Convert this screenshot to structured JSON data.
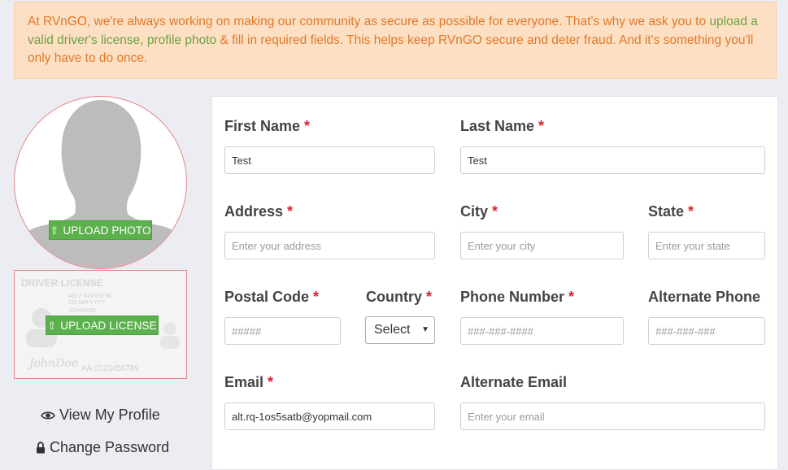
{
  "notice": {
    "part1": "At RVnGO, we're always working on making our community as secure as possible for everyone. That's why we ask you to",
    "highlight": "upload a valid driver's license, profile photo",
    "part2": "& fill in required fields. This helps keep RVnGO secure and deter fraud. And it's something you'll only have to do once."
  },
  "sidebar": {
    "upload_photo_label": "UPLOAD PHOTO",
    "upload_license_label": "UPLOAD LICENSE",
    "license_card": {
      "title": "DRIVER LICENSE",
      "line1": "A012 345 678 90",
      "line2": "DD-MM-YYYY",
      "line3": "JOHNDOE",
      "signature": "JohnDoe",
      "number": "AA 0123456789"
    },
    "view_profile": "View My Profile",
    "change_password": "Change Password"
  },
  "form": {
    "first_name": {
      "label": "First Name",
      "required": "*",
      "value": "Test",
      "placeholder": ""
    },
    "last_name": {
      "label": "Last Name",
      "required": "*",
      "value": "Test",
      "placeholder": ""
    },
    "address": {
      "label": "Address",
      "required": "*",
      "value": "",
      "placeholder": "Enter your address"
    },
    "city": {
      "label": "City",
      "required": "*",
      "value": "",
      "placeholder": "Enter your city"
    },
    "state": {
      "label": "State",
      "required": "*",
      "value": "",
      "placeholder": "Enter your state"
    },
    "postal_code": {
      "label": "Postal Code",
      "required": "*",
      "value": "",
      "placeholder": "#####"
    },
    "country": {
      "label": "Country",
      "required": "*",
      "selected": "Select"
    },
    "phone": {
      "label": "Phone Number",
      "required": "*",
      "value": "",
      "placeholder": "###-###-####"
    },
    "alt_phone": {
      "label": "Alternate Phone",
      "value": "",
      "placeholder": "###-###-###"
    },
    "email": {
      "label": "Email",
      "required": "*",
      "value": "alt.rq-1os5satb@yopmail.com",
      "placeholder": ""
    },
    "alt_email": {
      "label": "Alternate Email",
      "value": "",
      "placeholder": "Enter your email"
    }
  },
  "colors": {
    "notice_bg": "#fde0c3",
    "notice_text": "#e0782a",
    "notice_highlight": "#6fa043",
    "button_green": "#5cb04d",
    "required_star": "#d9232d"
  }
}
